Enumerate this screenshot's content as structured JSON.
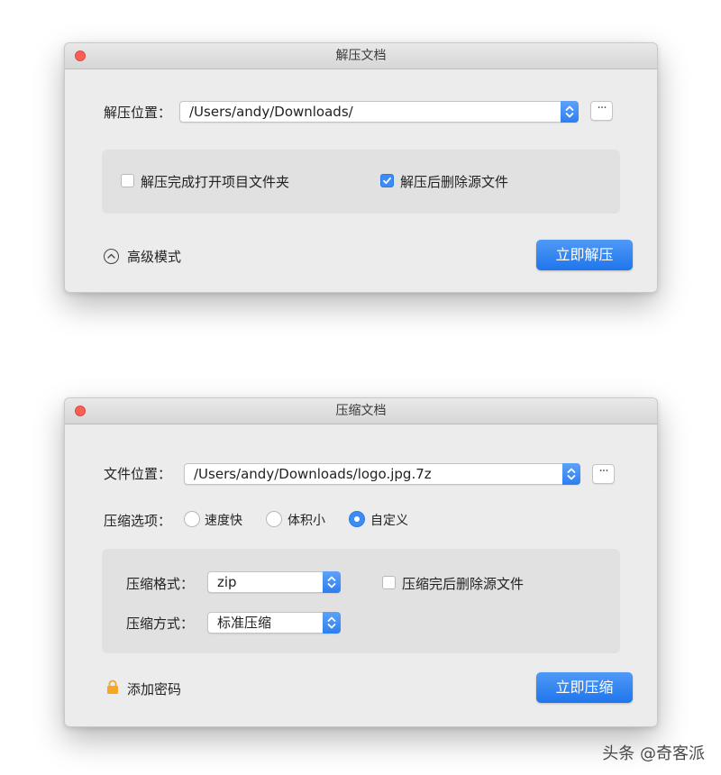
{
  "extract_window": {
    "title": "解压文档",
    "location_label": "解压位置：",
    "location_value": "/Users/andy/Downloads/",
    "more_label": "···",
    "options": [
      {
        "label": "解压完成打开项目文件夹",
        "checked": false
      },
      {
        "label": "解压后删除源文件",
        "checked": true
      }
    ],
    "advanced_label": "高级模式",
    "primary_button": "立即解压"
  },
  "compress_window": {
    "title": "压缩文档",
    "location_label": "文件位置：",
    "location_value": "/Users/andy/Downloads/logo.jpg.7z",
    "more_label": "···",
    "options_label": "压缩选项：",
    "radio_options": [
      {
        "label": "速度快",
        "checked": false
      },
      {
        "label": "体积小",
        "checked": false
      },
      {
        "label": "自定义",
        "checked": true
      }
    ],
    "format_label": "压缩格式：",
    "format_value": "zip",
    "method_label": "压缩方式：",
    "method_value": "标准压缩",
    "delete_source_label": "压缩完后删除源文件",
    "delete_source_checked": false,
    "password_label": "添加密码",
    "primary_button": "立即压缩"
  },
  "watermark": "头条 @奇客派",
  "colors": {
    "accent": "#3c8cf4",
    "close": "#fc5f57",
    "lock": "#f5a623",
    "window_bg": "#ececec",
    "panel_bg": "#e1e1e1"
  }
}
